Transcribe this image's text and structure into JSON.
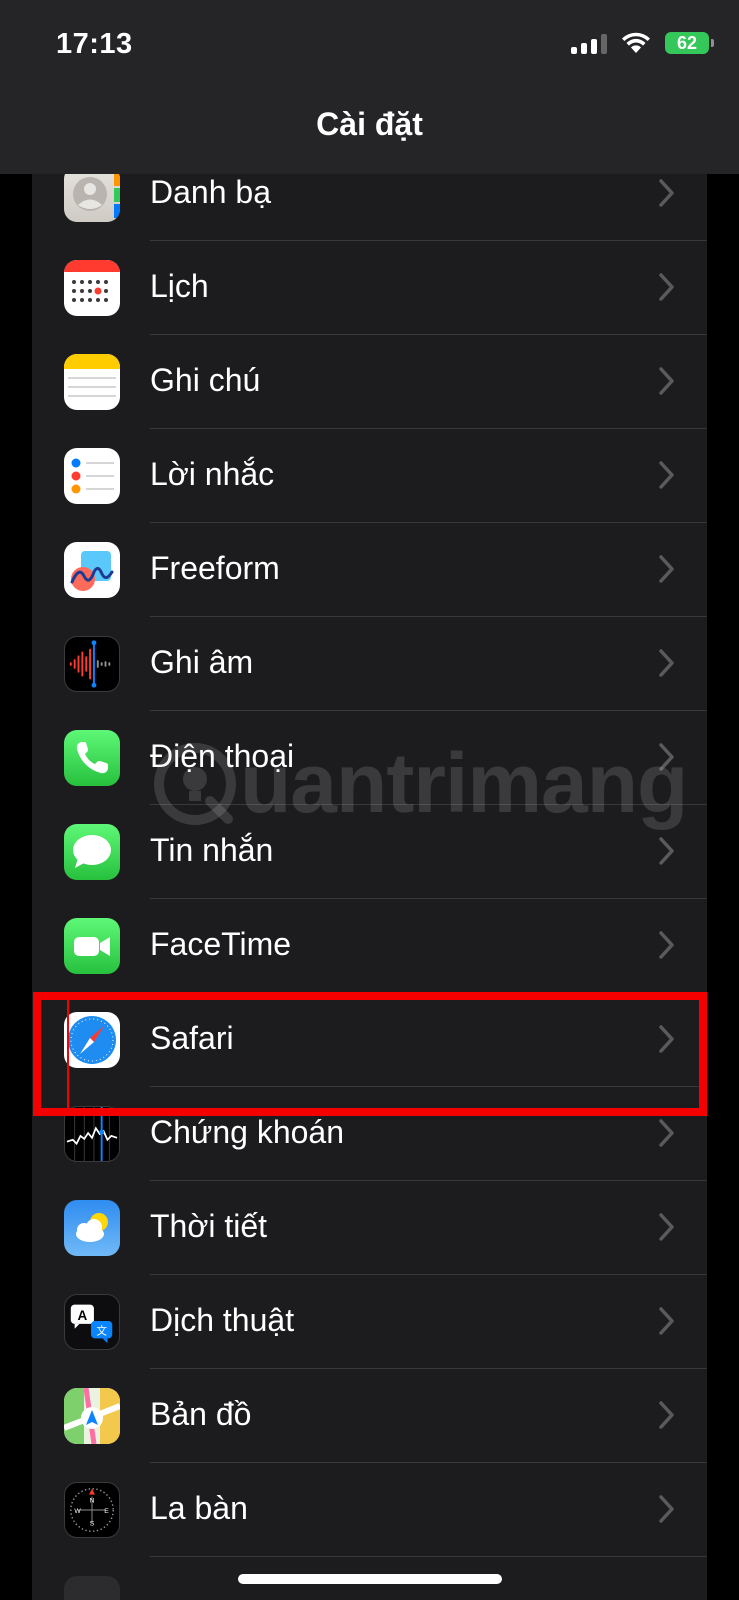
{
  "status": {
    "time": "17:13",
    "battery": "62"
  },
  "nav": {
    "title": "Cài đặt"
  },
  "rows": [
    {
      "label": "Danh bạ"
    },
    {
      "label": "Lịch"
    },
    {
      "label": "Ghi chú"
    },
    {
      "label": "Lời nhắc"
    },
    {
      "label": "Freeform"
    },
    {
      "label": "Ghi âm"
    },
    {
      "label": "Điện thoại"
    },
    {
      "label": "Tin nhắn"
    },
    {
      "label": "FaceTime"
    },
    {
      "label": "Safari"
    },
    {
      "label": "Chứng khoán"
    },
    {
      "label": "Thời tiết"
    },
    {
      "label": "Dịch thuật"
    },
    {
      "label": "Bản đồ"
    },
    {
      "label": "La bàn"
    }
  ],
  "watermark": {
    "text": "uantrimang"
  }
}
